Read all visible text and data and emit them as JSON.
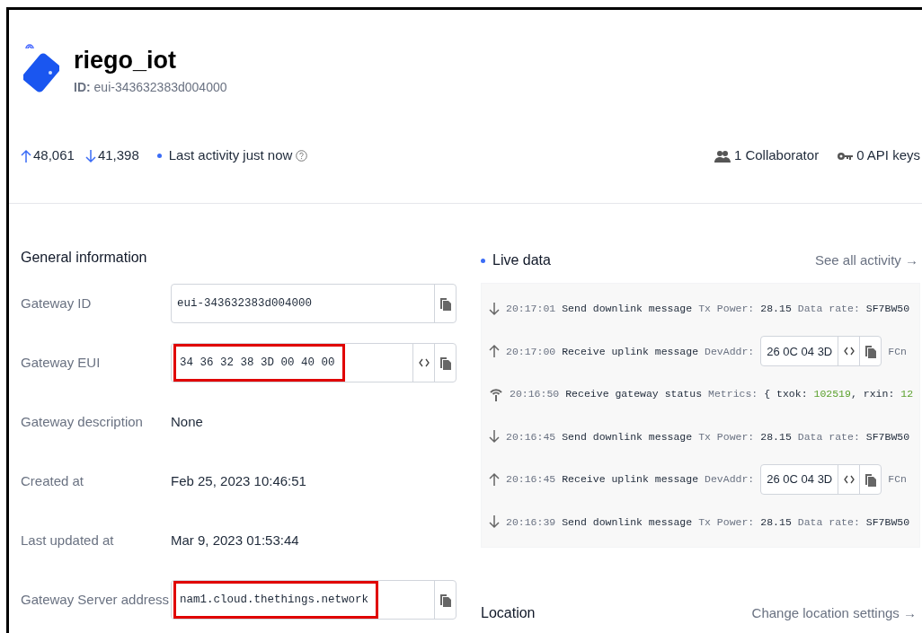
{
  "gateway": {
    "name": "riego_iot",
    "id_label": "ID:",
    "id": "eui-343632383d004000"
  },
  "stats": {
    "up": "48,061",
    "down": "41,398",
    "activity": "Last activity just now",
    "collaborators": "1 Collaborator",
    "api_keys": "0 API keys"
  },
  "general": {
    "title": "General information",
    "rows": [
      {
        "kind": "field",
        "label": "Gateway ID",
        "value": "eui-343632383d004000",
        "highlighted": false,
        "toggle": false
      },
      {
        "kind": "field",
        "label": "Gateway EUI",
        "value": "34 36 32 38 3D 00 40 00",
        "highlighted": true,
        "toggle": true
      },
      {
        "kind": "text",
        "label": "Gateway description",
        "value": "None"
      },
      {
        "kind": "text",
        "label": "Created at",
        "value": "Feb 25, 2023 10:46:51"
      },
      {
        "kind": "text",
        "label": "Last updated at",
        "value": "Mar 9, 2023 01:53:44"
      },
      {
        "kind": "field",
        "label": "Gateway Server address",
        "value": "nam1.cloud.thethings.network",
        "highlighted": true,
        "toggle": false
      }
    ]
  },
  "live": {
    "title": "Live data",
    "link": "See all activity →",
    "events": [
      {
        "kind": "downlink",
        "time": "20:17:01",
        "event": "Send downlink message",
        "fields": [
          {
            "label": "Tx Power:",
            "value": "28.15"
          },
          {
            "label": "Data rate:",
            "value": "SF7BW50"
          }
        ]
      },
      {
        "kind": "uplink",
        "time": "20:17:00",
        "event": "Receive uplink message",
        "label": "DevAddr:",
        "value": "26 0C 04 3D",
        "tail": "FCn"
      },
      {
        "kind": "status",
        "time": "20:16:50",
        "event": "Receive gateway status",
        "label": "Metrics:",
        "metrics": [
          {
            "key": "{ txok:",
            "value": "102519",
            "sep": ","
          },
          {
            "key": "rxin:",
            "value": "12"
          }
        ]
      },
      {
        "kind": "downlink",
        "time": "20:16:45",
        "event": "Send downlink message",
        "fields": [
          {
            "label": "Tx Power:",
            "value": "28.15"
          },
          {
            "label": "Data rate:",
            "value": "SF7BW50"
          }
        ]
      },
      {
        "kind": "uplink",
        "time": "20:16:45",
        "event": "Receive uplink message",
        "label": "DevAddr:",
        "value": "26 0C 04 3D",
        "tail": "FCn"
      },
      {
        "kind": "downlink",
        "time": "20:16:39",
        "event": "Send downlink message",
        "fields": [
          {
            "label": "Tx Power:",
            "value": "28.15"
          },
          {
            "label": "Data rate:",
            "value": "SF7BW50"
          }
        ]
      }
    ]
  },
  "location": {
    "title": "Location",
    "link": "Change location settings →"
  }
}
